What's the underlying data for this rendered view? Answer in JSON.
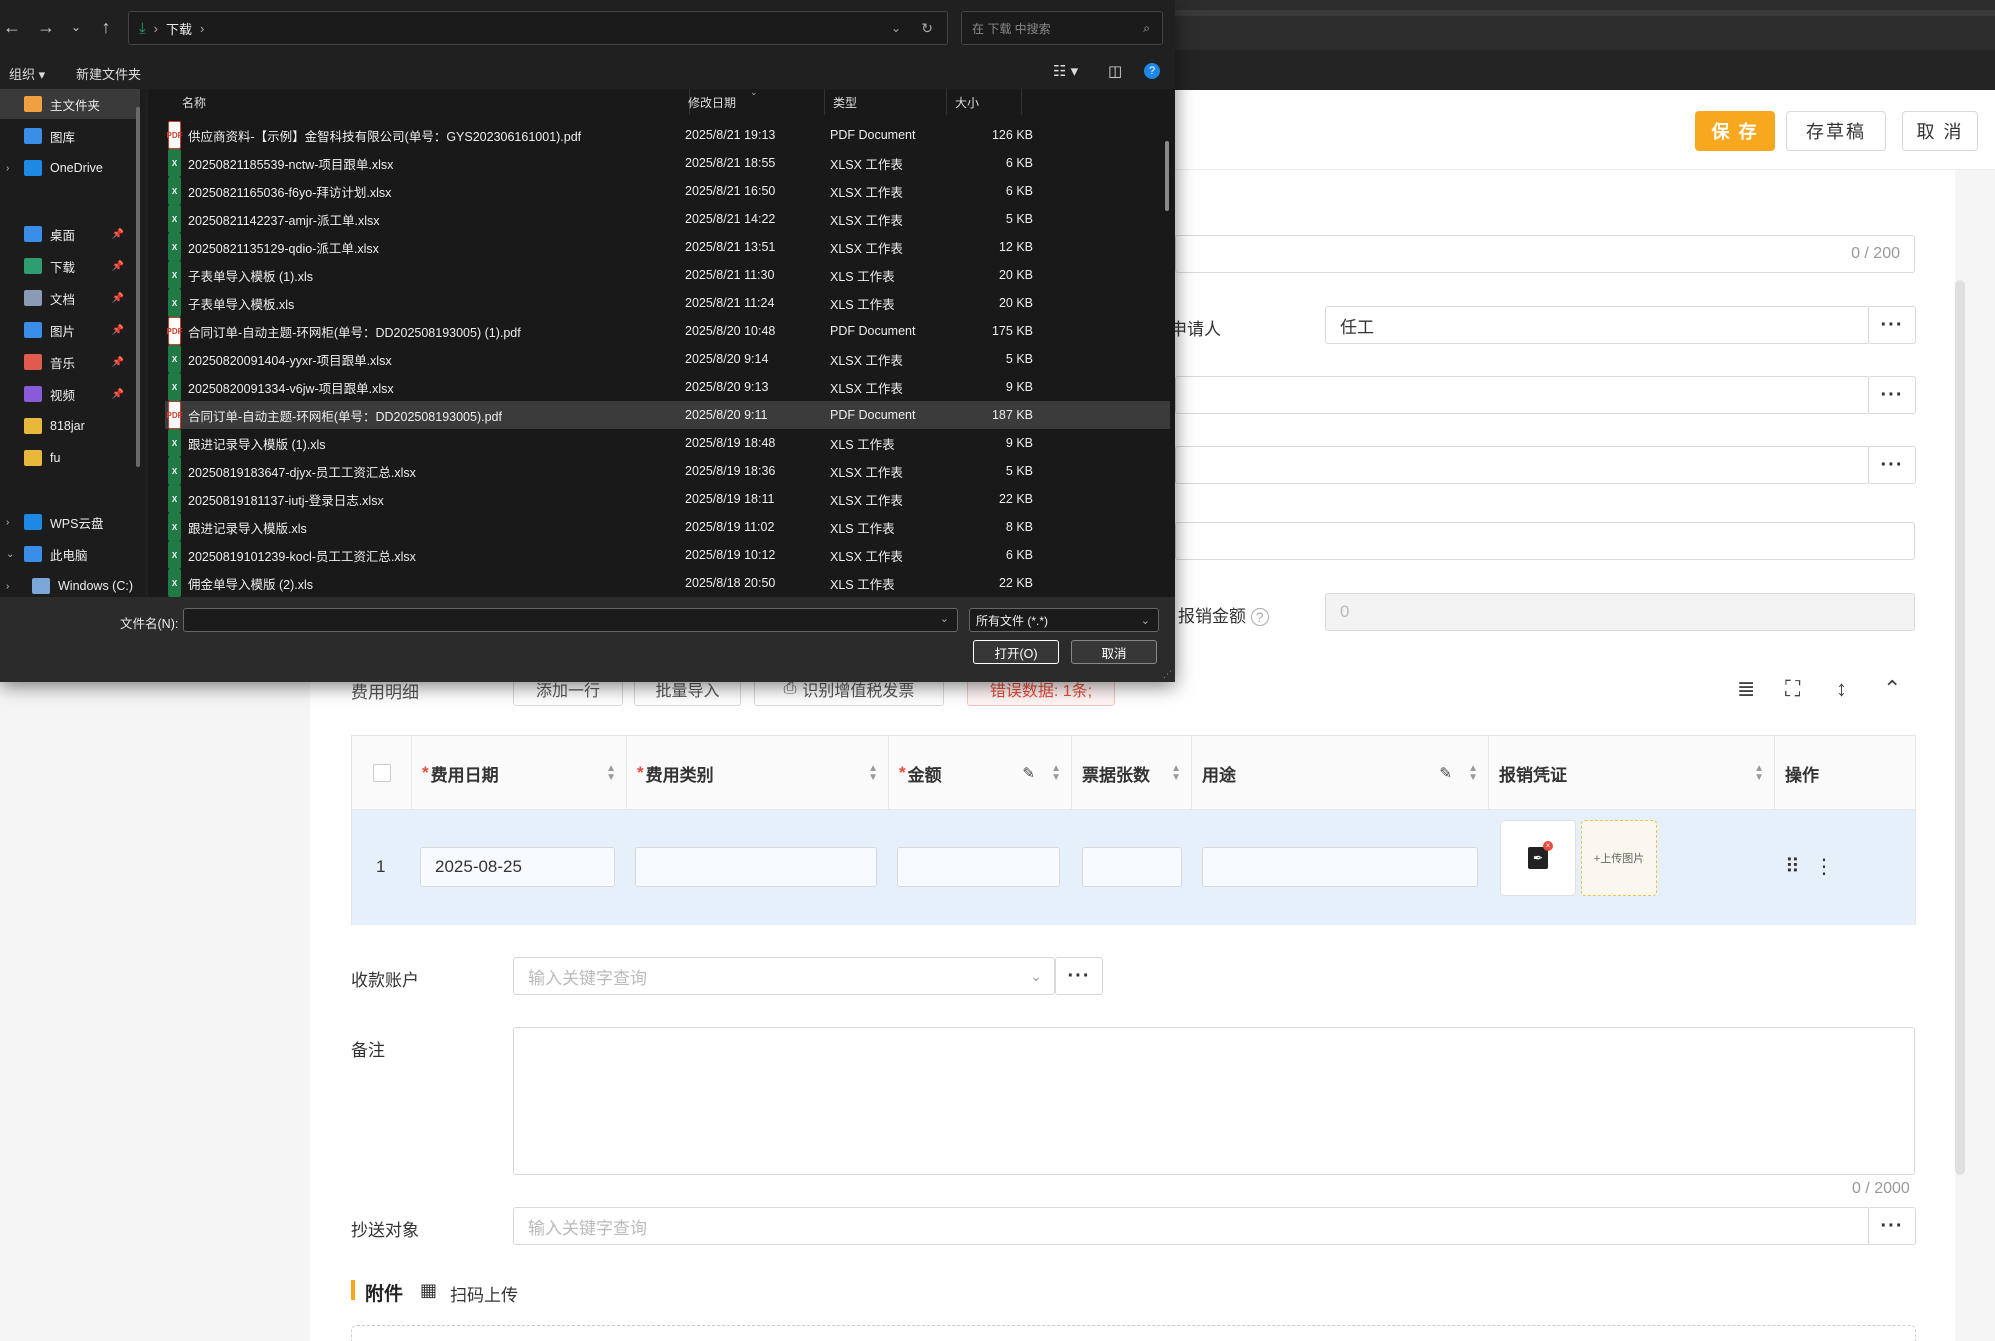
{
  "dialog": {
    "breadcrumb": "下载",
    "search_placeholder": "在 下载 中搜索",
    "cmd_organize": "组织",
    "cmd_new_folder": "新建文件夹",
    "nav": [
      {
        "label": "主文件夹",
        "icon": "home-icon",
        "selected": true
      },
      {
        "label": "图库",
        "icon": "gallery-icon"
      },
      {
        "label": "OneDrive",
        "icon": "cloud-icon"
      },
      {
        "label": "桌面",
        "icon": "desktop-icon",
        "pinned": true
      },
      {
        "label": "下载",
        "icon": "download-icon",
        "pinned": true
      },
      {
        "label": "文档",
        "icon": "document-icon",
        "pinned": true
      },
      {
        "label": "图片",
        "icon": "picture-icon",
        "pinned": true
      },
      {
        "label": "音乐",
        "icon": "music-icon",
        "pinned": true
      },
      {
        "label": "视频",
        "icon": "video-icon",
        "pinned": true
      },
      {
        "label": "818jar",
        "icon": "folder-icon"
      },
      {
        "label": "fu",
        "icon": "folder-icon"
      },
      {
        "label": "WPS云盘",
        "icon": "cloud-icon"
      },
      {
        "label": "此电脑",
        "icon": "computer-icon"
      },
      {
        "label": "Windows (C:)",
        "icon": "drive-icon"
      }
    ],
    "columns": {
      "name": "名称",
      "date": "修改日期",
      "type": "类型",
      "size": "大小"
    },
    "files": [
      {
        "name": "供应商资料-【示例】金智科技有限公司(单号：GYS202306161001).pdf",
        "date": "2025/8/21 19:13",
        "type": "PDF Document",
        "size": "126 KB",
        "kind": "pdf"
      },
      {
        "name": "20250821185539-nctw-项目跟单.xlsx",
        "date": "2025/8/21 18:55",
        "type": "XLSX 工作表",
        "size": "6 KB",
        "kind": "xls"
      },
      {
        "name": "20250821165036-f6yo-拜访计划.xlsx",
        "date": "2025/8/21 16:50",
        "type": "XLSX 工作表",
        "size": "6 KB",
        "kind": "xls"
      },
      {
        "name": "20250821142237-amjr-派工单.xlsx",
        "date": "2025/8/21 14:22",
        "type": "XLSX 工作表",
        "size": "5 KB",
        "kind": "xls"
      },
      {
        "name": "20250821135129-qdio-派工单.xlsx",
        "date": "2025/8/21 13:51",
        "type": "XLSX 工作表",
        "size": "12 KB",
        "kind": "xls"
      },
      {
        "name": "子表单导入模板 (1).xls",
        "date": "2025/8/21 11:30",
        "type": "XLS 工作表",
        "size": "20 KB",
        "kind": "xls"
      },
      {
        "name": "子表单导入模板.xls",
        "date": "2025/8/21 11:24",
        "type": "XLS 工作表",
        "size": "20 KB",
        "kind": "xls"
      },
      {
        "name": "合同订单-自动主题-环网柜(单号：DD202508193005) (1).pdf",
        "date": "2025/8/20 10:48",
        "type": "PDF Document",
        "size": "175 KB",
        "kind": "pdf"
      },
      {
        "name": "20250820091404-yyxr-项目跟单.xlsx",
        "date": "2025/8/20 9:14",
        "type": "XLSX 工作表",
        "size": "5 KB",
        "kind": "xls"
      },
      {
        "name": "20250820091334-v6jw-项目跟单.xlsx",
        "date": "2025/8/20 9:13",
        "type": "XLSX 工作表",
        "size": "9 KB",
        "kind": "xls"
      },
      {
        "name": "合同订单-自动主题-环网柜(单号：DD202508193005).pdf",
        "date": "2025/8/20 9:11",
        "type": "PDF Document",
        "size": "187 KB",
        "kind": "pdf",
        "selected": true
      },
      {
        "name": "跟进记录导入模版 (1).xls",
        "date": "2025/8/19 18:48",
        "type": "XLS 工作表",
        "size": "9 KB",
        "kind": "xls"
      },
      {
        "name": "20250819183647-djyx-员工工资汇总.xlsx",
        "date": "2025/8/19 18:36",
        "type": "XLSX 工作表",
        "size": "5 KB",
        "kind": "xls"
      },
      {
        "name": "20250819181137-iutj-登录日志.xlsx",
        "date": "2025/8/19 18:11",
        "type": "XLSX 工作表",
        "size": "22 KB",
        "kind": "xls"
      },
      {
        "name": "跟进记录导入模版.xls",
        "date": "2025/8/19 11:02",
        "type": "XLS 工作表",
        "size": "8 KB",
        "kind": "xls"
      },
      {
        "name": "20250819101239-kocl-员工工资汇总.xlsx",
        "date": "2025/8/19 10:12",
        "type": "XLSX 工作表",
        "size": "6 KB",
        "kind": "xls"
      },
      {
        "name": "佣金单导入模版 (2).xls",
        "date": "2025/8/18 20:50",
        "type": "XLS 工作表",
        "size": "22 KB",
        "kind": "xls"
      }
    ],
    "filename_label": "文件名(N):",
    "filename_value": "",
    "filter": "所有文件 (*.*)",
    "open_label": "打开(O)",
    "cancel_label": "取消"
  },
  "form": {
    "save_label": "保 存",
    "draft_label": "存草稿",
    "cancel_label": "取 消",
    "counter_200": "0 / 200",
    "applicant_label": "申请人",
    "applicant_value": "任工",
    "reimburse_label": "报销金额",
    "reimburse_value": "0",
    "detail_label": "费用明细",
    "detail_buttons": {
      "add_row": "添加一行",
      "bulk_import": "批量导入",
      "vat": "识别增值税发票",
      "error": "错误数据: 1条;"
    },
    "grid": {
      "headers": {
        "date": "费用日期",
        "category": "费用类别",
        "amount": "金额",
        "count": "票据张数",
        "purpose": "用途",
        "voucher": "报销凭证",
        "ops": "操作"
      },
      "row_index": "1",
      "row_date": "2025-08-25",
      "upload_label": "+上传图片"
    },
    "account_label": "收款账户",
    "account_placeholder": "输入关键字查询",
    "remark_label": "备注",
    "remark_counter": "0 / 2000",
    "cc_label": "抄送对象",
    "cc_placeholder": "输入关键字查询",
    "attach_label": "附件",
    "scan_label": "扫码上传"
  },
  "colors": {
    "accent": "#f7a81e",
    "required": "#e74c3c",
    "row_highlight": "#e6f0fa",
    "dialog_bg": "#202020"
  }
}
